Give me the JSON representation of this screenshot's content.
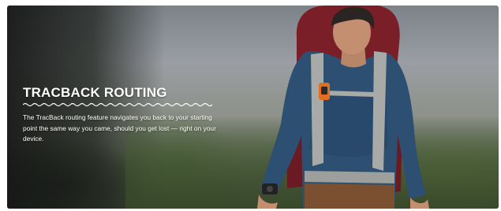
{
  "feature": {
    "title": "TRACBACK ROUTING",
    "description": "The TracBack routing feature navigates you back to your starting point the same way you came, should you get lost — right on your device."
  },
  "image": {
    "subject": "hiker-with-backpack",
    "colors": {
      "jacket": "#2d4f72",
      "backpack": "#7a1f28",
      "straps": "#a7aaa7",
      "text": "#ffffff"
    }
  }
}
